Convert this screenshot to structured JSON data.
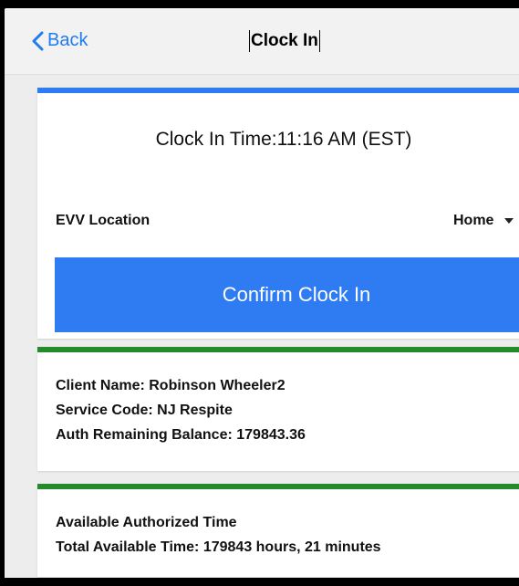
{
  "nav": {
    "back_label": "Back",
    "title": "Clock In"
  },
  "clock": {
    "time_text": "Clock In Time:11:16 AM (EST)",
    "evv_label": "EVV Location",
    "evv_value": "Home",
    "confirm_label": "Confirm Clock In"
  },
  "client": {
    "name_line": "Client Name: Robinson Wheeler2",
    "service_line": "Service Code: NJ Respite",
    "balance_line": "Auth Remaining Balance: 179843.36"
  },
  "availability": {
    "heading": "Available Authorized Time",
    "total_line": "Total Available Time: 179843 hours, 21 minutes"
  },
  "colors": {
    "accent_blue": "#2f7cf2",
    "green_bar": "#238b2b",
    "link_blue": "#1f7bf0",
    "orange_marker": "#e68a3c"
  }
}
